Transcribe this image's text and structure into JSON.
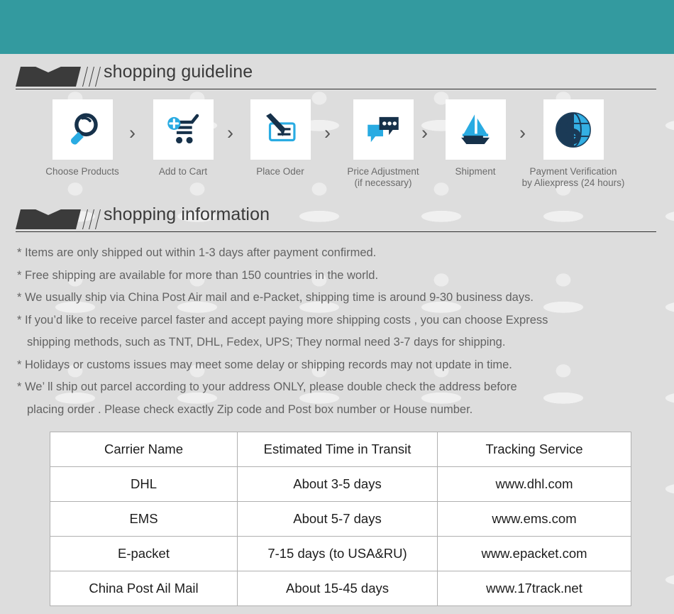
{
  "theme": {
    "topbar_color": "#339a9f",
    "page_bg": "#dddddd",
    "banner_color": "#3b3b3b",
    "icon_dark": "#1b3a56",
    "icon_blue": "#29abe2",
    "text_gray": "#636363",
    "table_border": "#b0b0b0"
  },
  "sections": {
    "guideline": {
      "title": "shopping guideline"
    },
    "information": {
      "title": "shopping information"
    }
  },
  "steps": [
    {
      "icon": "magnifier-icon",
      "caption_line1": "Choose Products",
      "caption_line2": ""
    },
    {
      "icon": "cart-plus-icon",
      "caption_line1": "Add to Cart",
      "caption_line2": ""
    },
    {
      "icon": "sign-order-icon",
      "caption_line1": "Place Oder",
      "caption_line2": ""
    },
    {
      "icon": "chat-bubbles-icon",
      "caption_line1": "Price Adjustment",
      "caption_line2": "(if necessary)"
    },
    {
      "icon": "sailboat-icon",
      "caption_line1": "Shipment",
      "caption_line2": ""
    },
    {
      "icon": "dollar-globe-icon",
      "caption_line1": "Payment Verification",
      "caption_line2": "by  Aliexpress (24 hours)"
    }
  ],
  "step_separator": "›",
  "info_lines": [
    {
      "text": "* Items are only shipped out within 1-3 days after payment confirmed.",
      "indent": false
    },
    {
      "text": "* Free shipping are available for more than 150 countries in the world.",
      "indent": false
    },
    {
      "text": "* We usually ship via China Post Air mail and e-Packet, shipping time is around 9-30 business days.",
      "indent": false
    },
    {
      "text": "* If you’d like to receive parcel faster and accept paying more shipping costs , you can choose Express",
      "indent": false
    },
    {
      "text": "shipping methods, such as TNT, DHL, Fedex, UPS; They normal need 3-7 days for shipping.",
      "indent": true
    },
    {
      "text": "* Holidays or customs issues may meet some delay or shipping records may not update in time.",
      "indent": false
    },
    {
      "text": "* We’ ll ship out parcel according to your address ONLY, please double check the address before",
      "indent": false
    },
    {
      "text": "placing order . Please check exactly Zip code and Post box number or House number.",
      "indent": true
    }
  ],
  "table": {
    "headers": [
      "Carrier Name",
      "Estimated Time in Transit",
      "Tracking Service"
    ],
    "rows": [
      [
        "DHL",
        "About 3-5 days",
        "www.dhl.com"
      ],
      [
        "EMS",
        "About 5-7 days",
        "www.ems.com"
      ],
      [
        "E-packet",
        "7-15 days (to USA&RU)",
        "www.epacket.com"
      ],
      [
        "China Post Ail Mail",
        "About 15-45 days",
        "www.17track.net"
      ]
    ]
  }
}
